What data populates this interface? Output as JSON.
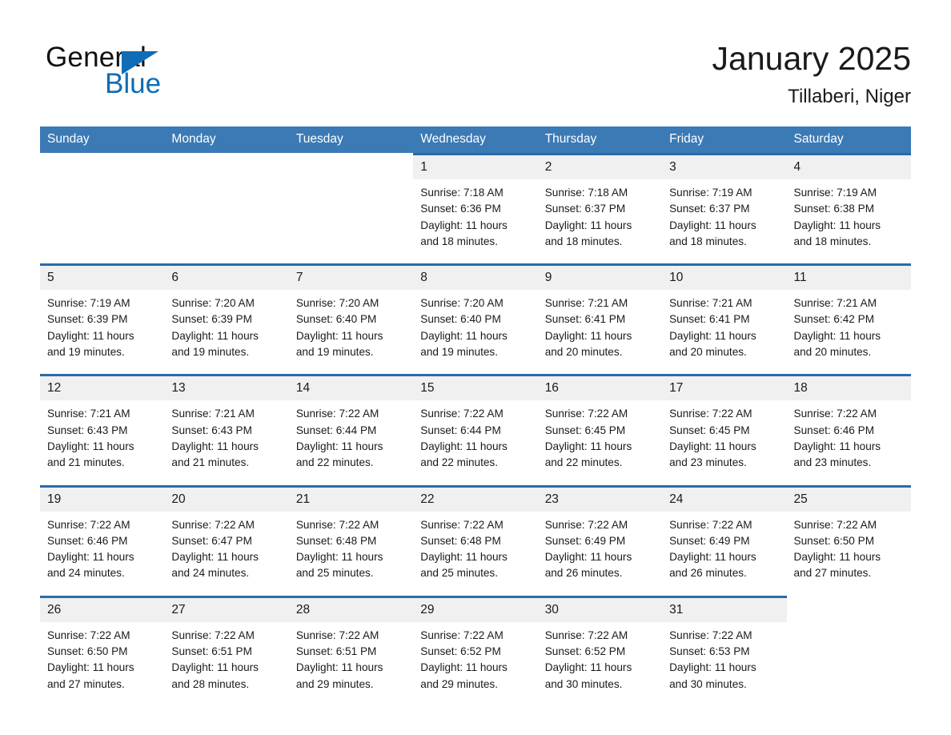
{
  "brand": {
    "name_top": "General",
    "name_bottom": "Blue",
    "accent_color": "#0f6cb5",
    "triangle_icon": "triangle-icon"
  },
  "header": {
    "title": "January 2025",
    "subtitle": "Tillaberi, Niger"
  },
  "theme": {
    "header_bg": "#3b7ab5",
    "row_rule": "#2a6ca8",
    "daynum_bg": "#f0f0f0",
    "text": "#1a1a1a"
  },
  "calendar": {
    "weekday_headers": [
      "Sunday",
      "Monday",
      "Tuesday",
      "Wednesday",
      "Thursday",
      "Friday",
      "Saturday"
    ],
    "weeks": [
      [
        {
          "blank": true
        },
        {
          "blank": true
        },
        {
          "blank": true
        },
        {
          "day": "1",
          "sunrise": "Sunrise: 7:18 AM",
          "sunset": "Sunset: 6:36 PM",
          "daylight_1": "Daylight: 11 hours",
          "daylight_2": "and 18 minutes."
        },
        {
          "day": "2",
          "sunrise": "Sunrise: 7:18 AM",
          "sunset": "Sunset: 6:37 PM",
          "daylight_1": "Daylight: 11 hours",
          "daylight_2": "and 18 minutes."
        },
        {
          "day": "3",
          "sunrise": "Sunrise: 7:19 AM",
          "sunset": "Sunset: 6:37 PM",
          "daylight_1": "Daylight: 11 hours",
          "daylight_2": "and 18 minutes."
        },
        {
          "day": "4",
          "sunrise": "Sunrise: 7:19 AM",
          "sunset": "Sunset: 6:38 PM",
          "daylight_1": "Daylight: 11 hours",
          "daylight_2": "and 18 minutes."
        }
      ],
      [
        {
          "day": "5",
          "sunrise": "Sunrise: 7:19 AM",
          "sunset": "Sunset: 6:39 PM",
          "daylight_1": "Daylight: 11 hours",
          "daylight_2": "and 19 minutes."
        },
        {
          "day": "6",
          "sunrise": "Sunrise: 7:20 AM",
          "sunset": "Sunset: 6:39 PM",
          "daylight_1": "Daylight: 11 hours",
          "daylight_2": "and 19 minutes."
        },
        {
          "day": "7",
          "sunrise": "Sunrise: 7:20 AM",
          "sunset": "Sunset: 6:40 PM",
          "daylight_1": "Daylight: 11 hours",
          "daylight_2": "and 19 minutes."
        },
        {
          "day": "8",
          "sunrise": "Sunrise: 7:20 AM",
          "sunset": "Sunset: 6:40 PM",
          "daylight_1": "Daylight: 11 hours",
          "daylight_2": "and 19 minutes."
        },
        {
          "day": "9",
          "sunrise": "Sunrise: 7:21 AM",
          "sunset": "Sunset: 6:41 PM",
          "daylight_1": "Daylight: 11 hours",
          "daylight_2": "and 20 minutes."
        },
        {
          "day": "10",
          "sunrise": "Sunrise: 7:21 AM",
          "sunset": "Sunset: 6:41 PM",
          "daylight_1": "Daylight: 11 hours",
          "daylight_2": "and 20 minutes."
        },
        {
          "day": "11",
          "sunrise": "Sunrise: 7:21 AM",
          "sunset": "Sunset: 6:42 PM",
          "daylight_1": "Daylight: 11 hours",
          "daylight_2": "and 20 minutes."
        }
      ],
      [
        {
          "day": "12",
          "sunrise": "Sunrise: 7:21 AM",
          "sunset": "Sunset: 6:43 PM",
          "daylight_1": "Daylight: 11 hours",
          "daylight_2": "and 21 minutes."
        },
        {
          "day": "13",
          "sunrise": "Sunrise: 7:21 AM",
          "sunset": "Sunset: 6:43 PM",
          "daylight_1": "Daylight: 11 hours",
          "daylight_2": "and 21 minutes."
        },
        {
          "day": "14",
          "sunrise": "Sunrise: 7:22 AM",
          "sunset": "Sunset: 6:44 PM",
          "daylight_1": "Daylight: 11 hours",
          "daylight_2": "and 22 minutes."
        },
        {
          "day": "15",
          "sunrise": "Sunrise: 7:22 AM",
          "sunset": "Sunset: 6:44 PM",
          "daylight_1": "Daylight: 11 hours",
          "daylight_2": "and 22 minutes."
        },
        {
          "day": "16",
          "sunrise": "Sunrise: 7:22 AM",
          "sunset": "Sunset: 6:45 PM",
          "daylight_1": "Daylight: 11 hours",
          "daylight_2": "and 22 minutes."
        },
        {
          "day": "17",
          "sunrise": "Sunrise: 7:22 AM",
          "sunset": "Sunset: 6:45 PM",
          "daylight_1": "Daylight: 11 hours",
          "daylight_2": "and 23 minutes."
        },
        {
          "day": "18",
          "sunrise": "Sunrise: 7:22 AM",
          "sunset": "Sunset: 6:46 PM",
          "daylight_1": "Daylight: 11 hours",
          "daylight_2": "and 23 minutes."
        }
      ],
      [
        {
          "day": "19",
          "sunrise": "Sunrise: 7:22 AM",
          "sunset": "Sunset: 6:46 PM",
          "daylight_1": "Daylight: 11 hours",
          "daylight_2": "and 24 minutes."
        },
        {
          "day": "20",
          "sunrise": "Sunrise: 7:22 AM",
          "sunset": "Sunset: 6:47 PM",
          "daylight_1": "Daylight: 11 hours",
          "daylight_2": "and 24 minutes."
        },
        {
          "day": "21",
          "sunrise": "Sunrise: 7:22 AM",
          "sunset": "Sunset: 6:48 PM",
          "daylight_1": "Daylight: 11 hours",
          "daylight_2": "and 25 minutes."
        },
        {
          "day": "22",
          "sunrise": "Sunrise: 7:22 AM",
          "sunset": "Sunset: 6:48 PM",
          "daylight_1": "Daylight: 11 hours",
          "daylight_2": "and 25 minutes."
        },
        {
          "day": "23",
          "sunrise": "Sunrise: 7:22 AM",
          "sunset": "Sunset: 6:49 PM",
          "daylight_1": "Daylight: 11 hours",
          "daylight_2": "and 26 minutes."
        },
        {
          "day": "24",
          "sunrise": "Sunrise: 7:22 AM",
          "sunset": "Sunset: 6:49 PM",
          "daylight_1": "Daylight: 11 hours",
          "daylight_2": "and 26 minutes."
        },
        {
          "day": "25",
          "sunrise": "Sunrise: 7:22 AM",
          "sunset": "Sunset: 6:50 PM",
          "daylight_1": "Daylight: 11 hours",
          "daylight_2": "and 27 minutes."
        }
      ],
      [
        {
          "day": "26",
          "sunrise": "Sunrise: 7:22 AM",
          "sunset": "Sunset: 6:50 PM",
          "daylight_1": "Daylight: 11 hours",
          "daylight_2": "and 27 minutes."
        },
        {
          "day": "27",
          "sunrise": "Sunrise: 7:22 AM",
          "sunset": "Sunset: 6:51 PM",
          "daylight_1": "Daylight: 11 hours",
          "daylight_2": "and 28 minutes."
        },
        {
          "day": "28",
          "sunrise": "Sunrise: 7:22 AM",
          "sunset": "Sunset: 6:51 PM",
          "daylight_1": "Daylight: 11 hours",
          "daylight_2": "and 29 minutes."
        },
        {
          "day": "29",
          "sunrise": "Sunrise: 7:22 AM",
          "sunset": "Sunset: 6:52 PM",
          "daylight_1": "Daylight: 11 hours",
          "daylight_2": "and 29 minutes."
        },
        {
          "day": "30",
          "sunrise": "Sunrise: 7:22 AM",
          "sunset": "Sunset: 6:52 PM",
          "daylight_1": "Daylight: 11 hours",
          "daylight_2": "and 30 minutes."
        },
        {
          "day": "31",
          "sunrise": "Sunrise: 7:22 AM",
          "sunset": "Sunset: 6:53 PM",
          "daylight_1": "Daylight: 11 hours",
          "daylight_2": "and 30 minutes."
        },
        {
          "blank": true
        }
      ]
    ]
  }
}
